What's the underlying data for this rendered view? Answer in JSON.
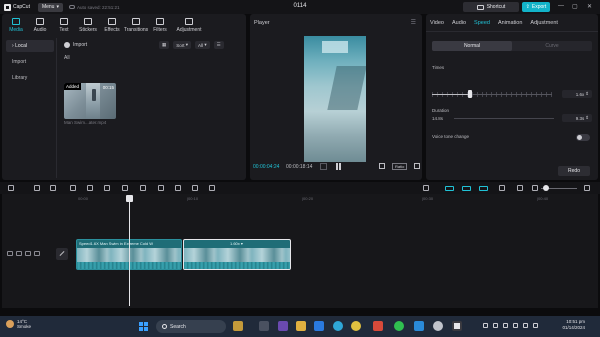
{
  "titlebar": {
    "app_name": "CapCut",
    "menu_label": "Menu",
    "autosave": "Auto saved: 22:51:21",
    "window_title": "0114",
    "shortcut_label": "Shortcut",
    "export_label": "Export",
    "controls": [
      "—",
      "▢",
      "✕"
    ]
  },
  "media_toolbar": {
    "tabs": [
      {
        "label": "Media",
        "active": true
      },
      {
        "label": "Audio"
      },
      {
        "label": "Text"
      },
      {
        "label": "Stickers"
      },
      {
        "label": "Effects"
      },
      {
        "label": "Transitions"
      },
      {
        "label": "Filters"
      },
      {
        "label": "Adjustment"
      }
    ]
  },
  "media_sidenav": {
    "items": [
      {
        "label": "Local",
        "active": true
      },
      {
        "label": "Import"
      },
      {
        "label": "Library"
      }
    ]
  },
  "media_content": {
    "import_label": "Import",
    "sort_label": "Sort",
    "filter_label": "All",
    "section_label": "All",
    "card": {
      "badge": "Added",
      "duration": "00:15",
      "name": "Man Swim...ater.mp4"
    }
  },
  "player": {
    "title": "Player",
    "current_time": "00:00:04:24",
    "total_time": "00:00:18:14",
    "ratio_label": "Ratio"
  },
  "properties": {
    "tabs": [
      {
        "label": "Video"
      },
      {
        "label": "Audio"
      },
      {
        "label": "Speed",
        "active": true
      },
      {
        "label": "Animation"
      },
      {
        "label": "Adjustment"
      }
    ],
    "modes": [
      {
        "label": "Normal",
        "active": true
      },
      {
        "label": "Curve"
      }
    ],
    "times_label": "Times",
    "times_value": "1.6x",
    "times_fraction": 0.32,
    "duration_label": "Duration",
    "duration_from": "14.8s",
    "duration_value": "9.3s",
    "voice_label": "Voice tone change",
    "redo_label": "Redo"
  },
  "timeline": {
    "ruler_labels": [
      "00:00",
      "|00:10",
      "|00:20",
      "|00:30",
      "|00:40"
    ],
    "clip_label": "Speed1.6X   Man Swim in Extreme Cold W",
    "clip_speed": "1.60x ▾"
  },
  "taskbar": {
    "temperature": "14°C",
    "weather": "Smoke",
    "search_placeholder": "Search",
    "time": "10:51 pm",
    "date": "01/14/2024"
  },
  "colors": {
    "accent": "#21c2d6",
    "export": "#12b3c9",
    "panel": "#1b1b1f",
    "clip": "#1f6d77",
    "taskbar": "#202a3a"
  }
}
